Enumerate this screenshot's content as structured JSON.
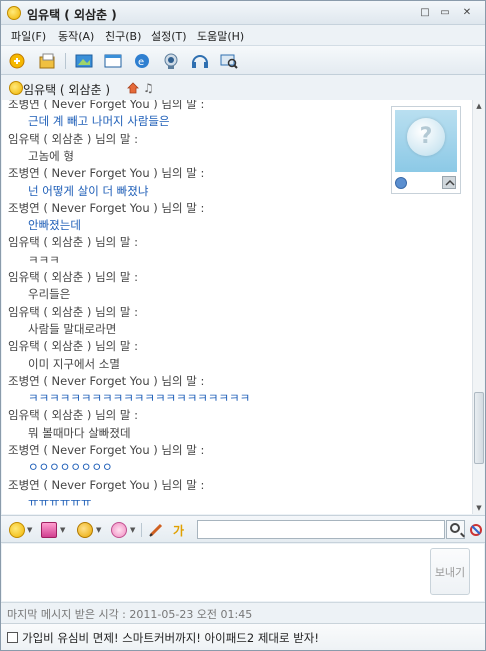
{
  "window": {
    "title": "임유택 ( 외삼춘 )",
    "controls": {
      "restore": "□",
      "minimize": "▭",
      "close": "✕"
    }
  },
  "menu": {
    "items": [
      "파일(F)",
      "동작(A)",
      "친구(B)",
      "설정(T)",
      "도움말(H)"
    ]
  },
  "toolbar": {
    "icons": [
      "add-friend-icon",
      "send-file-icon",
      "share-screen-icon",
      "window-icon",
      "ie-icon",
      "webcam-icon",
      "headset-icon",
      "search-display-icon"
    ]
  },
  "contact": {
    "name": "임유택 ( 외삼춘 )",
    "icons": [
      "emoticon-icon",
      "home-icon",
      "music-icon"
    ]
  },
  "chat": {
    "lines": [
      {
        "type": "header",
        "text": "조병연 ( Never Forget You ) 님의 말 :"
      },
      {
        "type": "body-blue",
        "text": "근데 계 빼고 나머지 사람들은"
      },
      {
        "type": "header",
        "text": "임유택 ( 외삼춘 ) 님의 말 :"
      },
      {
        "type": "body",
        "text": "고놈에 형"
      },
      {
        "type": "header",
        "text": "조병연 ( Never Forget You ) 님의 말 :"
      },
      {
        "type": "body-blue",
        "text": "넌 어떻게 살이 더 빠졌냐"
      },
      {
        "type": "header",
        "text": "조병연 ( Never Forget You ) 님의 말 :"
      },
      {
        "type": "body-blue",
        "text": "안빠졌는데"
      },
      {
        "type": "header",
        "text": "임유택 ( 외삼춘 ) 님의 말 :"
      },
      {
        "type": "body",
        "text": "ㅋㅋㅋ"
      },
      {
        "type": "header",
        "text": "임유택 ( 외삼춘 ) 님의 말 :"
      },
      {
        "type": "body",
        "text": "우리들은"
      },
      {
        "type": "header",
        "text": "임유택 ( 외삼춘 ) 님의 말 :"
      },
      {
        "type": "body",
        "text": "사람들 말대로라면"
      },
      {
        "type": "header",
        "text": "임유택 ( 외삼춘 ) 님의 말 :"
      },
      {
        "type": "body",
        "text": "이미 지구에서 소멸"
      },
      {
        "type": "header",
        "text": "조병연 ( Never Forget You ) 님의 말 :"
      },
      {
        "type": "body-blue",
        "text": "ㅋㅋㅋㅋㅋㅋㅋㅋㅋㅋㅋㅋㅋㅋㅋㅋㅋㅋㅋㅋㅋ"
      },
      {
        "type": "header",
        "text": "임유택 ( 외삼춘 ) 님의 말 :"
      },
      {
        "type": "body",
        "text": "뭐 볼때마다 살빠졌데"
      },
      {
        "type": "header",
        "text": "조병연 ( Never Forget You ) 님의 말 :"
      },
      {
        "type": "body-blue",
        "text": "ㅇㅇㅇㅇㅇㅇㅇㅇ"
      },
      {
        "type": "header",
        "text": "조병연 ( Never Forget You ) 님의 말 :"
      },
      {
        "type": "body-blue",
        "text": "ㅠㅠㅠㅠㅠㅠ"
      }
    ],
    "avatar_icon": "question-bubble-icon"
  },
  "format_toolbar": {
    "icons": [
      "emoticon-icon",
      "nudge-icon",
      "character-icon",
      "flower-icon",
      "pen-icon",
      "font-icon"
    ],
    "search_value": ""
  },
  "input": {
    "send_label": "보내기"
  },
  "status": {
    "text": "마지막 메시지 받은 시각 : 2011-05-23 오전 01:45"
  },
  "ad": {
    "text": "가입비 유심비 면제! 스마트커버까지! 아이패드2 제대로 받자!"
  }
}
